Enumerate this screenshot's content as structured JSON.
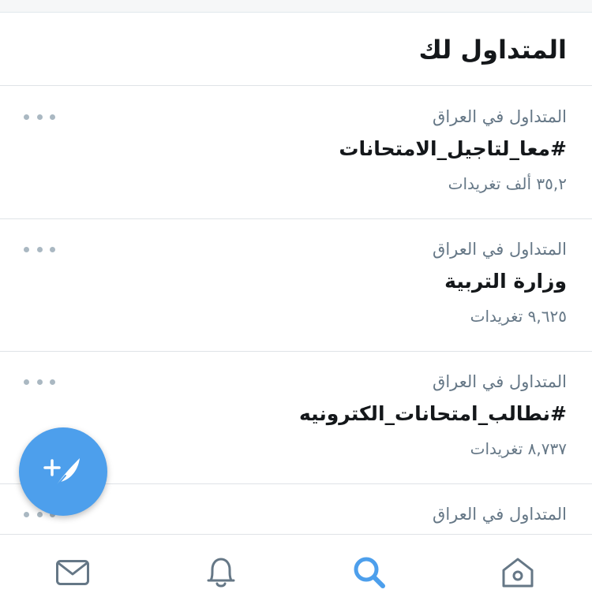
{
  "header": {
    "title": "المتداول لك"
  },
  "trends": [
    {
      "context": "المتداول في العراق",
      "name": "#معا_لتاجيل_الامتحانات",
      "count": "٣٥,٢ ألف تغريدات"
    },
    {
      "context": "المتداول في العراق",
      "name": "وزارة التربية",
      "count": "٩,٦٢٥ تغريدات"
    },
    {
      "context": "المتداول في العراق",
      "name": "#نطالب_امتحانات_الكترونيه",
      "count": "٨,٧٣٧ تغريدات"
    },
    {
      "context": "المتداول في العراق",
      "name": "",
      "count": ""
    }
  ],
  "tab_bar": {
    "tabs": [
      {
        "icon": "mail-icon"
      },
      {
        "icon": "bell-icon"
      },
      {
        "icon": "search-icon",
        "active": true
      },
      {
        "icon": "home-icon"
      }
    ]
  },
  "fab": {
    "icon": "compose-tweet-icon"
  },
  "colors": {
    "accent": "#4d9fec",
    "tab_icon": "#657786",
    "secondary_text": "#657786"
  }
}
